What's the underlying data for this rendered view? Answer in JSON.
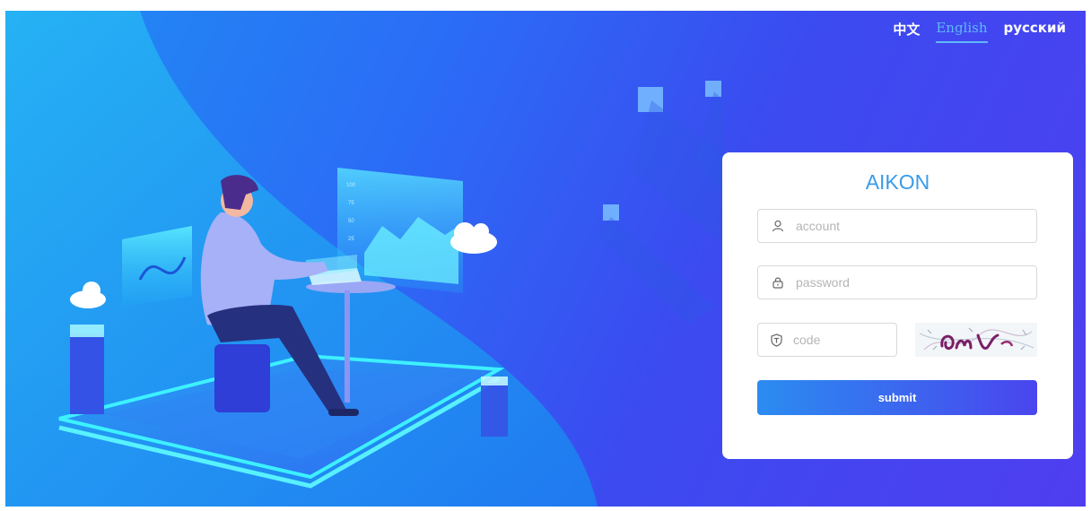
{
  "languages": [
    {
      "label": "中文",
      "active": false
    },
    {
      "label": "English",
      "active": true
    },
    {
      "label": "русский",
      "active": false
    }
  ],
  "login": {
    "brand": "AIKON",
    "account_placeholder": "account",
    "password_placeholder": "password",
    "code_placeholder": "code",
    "submit_label": "submit",
    "account_icon": "user-icon",
    "password_icon": "lock-icon",
    "code_icon": "shield-icon"
  },
  "illustration": {
    "chart_ticks": [
      "100",
      "75",
      "50",
      "25"
    ]
  },
  "colors": {
    "background_start": "#1f8df3",
    "background_end": "#4f3ef0",
    "brand": "#3a9be8",
    "active_language": "#5fb8f7",
    "button_start": "#2b8cf0",
    "button_end": "#4a45ee"
  }
}
